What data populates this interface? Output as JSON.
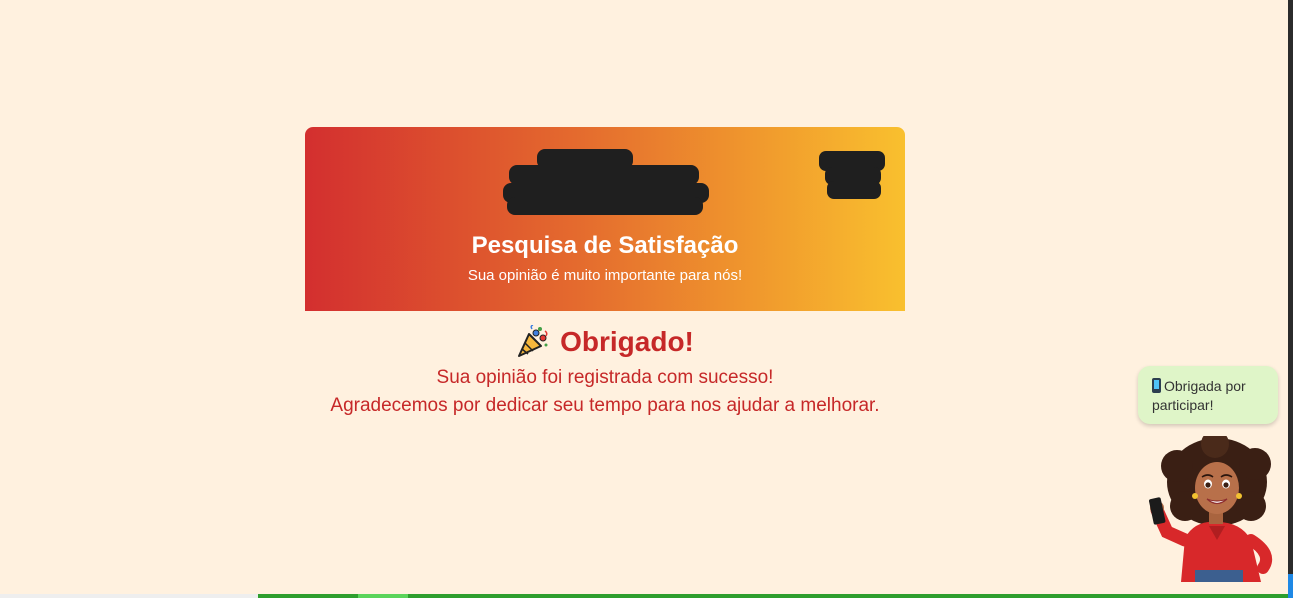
{
  "banner": {
    "title": "Pesquisa de Satisfação",
    "subtitle": "Sua opinião é muito importante para nós!"
  },
  "thanks": {
    "icon": "party-popper-icon",
    "title": "Obrigado!",
    "line1": "Sua opinião foi registrada com sucesso!",
    "line2": "Agradecemos por dedicar seu tempo para nos ajudar a melhorar."
  },
  "assistant": {
    "bubble_text": "Obrigada por participar!",
    "bubble_icon": "mobile-phone-icon",
    "avatar": "assistant-avatar"
  },
  "colors": {
    "background": "#fff1df",
    "accent_red": "#c62828",
    "gradient_start": "#d32f2f",
    "gradient_end": "#f9c02e",
    "bubble": "#dff5c8"
  }
}
